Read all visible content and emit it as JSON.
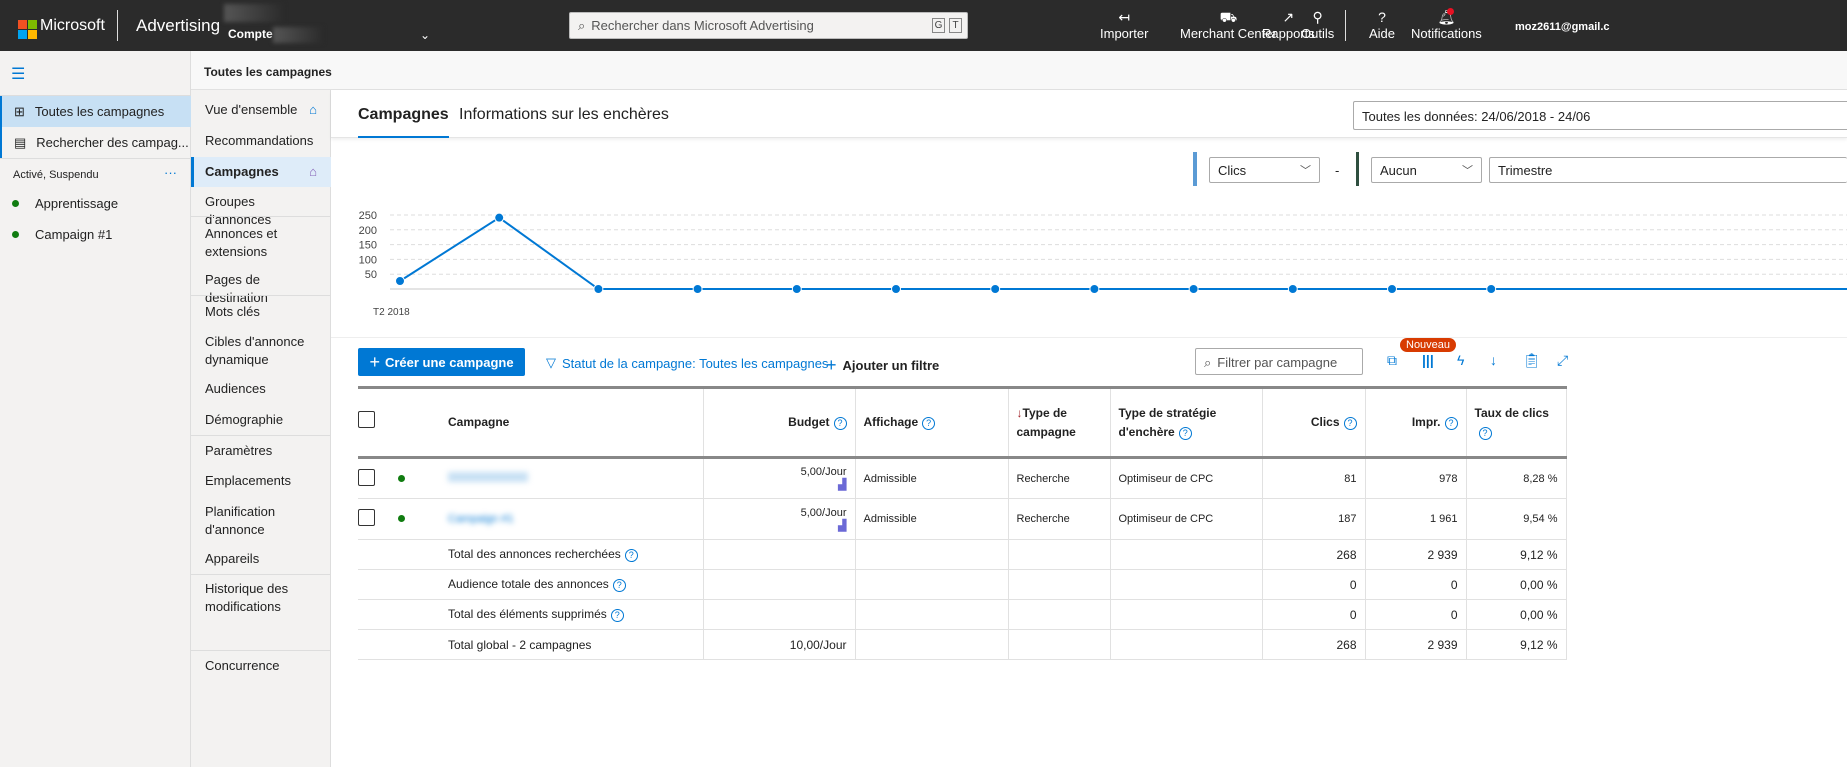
{
  "topbar": {
    "brand": "Microsoft",
    "product": "Advertising",
    "account_label": "Compte",
    "search_placeholder": "Rechercher dans Microsoft Advertising",
    "kbd": [
      "G",
      "T"
    ],
    "nav": [
      {
        "label": "Importer",
        "icon": "import-icon",
        "glyph": "↤"
      },
      {
        "label": "Merchant Center",
        "icon": "cart-icon",
        "glyph": "🛒"
      },
      {
        "label": "Rapports",
        "icon": "chart-icon",
        "glyph": "📈"
      },
      {
        "label": "Outils",
        "icon": "wrench-icon",
        "glyph": "🔧"
      },
      {
        "label": "Aide",
        "icon": "help-icon",
        "glyph": "?"
      },
      {
        "label": "Notifications",
        "icon": "bell-icon",
        "glyph": "🔔"
      }
    ],
    "user": "moz2611@gmail.c"
  },
  "breadcrumb": "Toutes les campagnes",
  "left": {
    "items": [
      "Toutes les campagnes",
      "Rechercher des campag..."
    ],
    "filter_label": "Activé, Suspendu",
    "more": "···",
    "campaigns": [
      "Apprentissage",
      "Campaign #1"
    ]
  },
  "menu": [
    "Vue d'ensemble",
    "Recommandations",
    "Campagnes",
    "Groupes d'annonces",
    "Annonces et extensions",
    "Pages de destination",
    "Mots clés",
    "Cibles d'annonce dynamique",
    "Audiences",
    "Démographie",
    "Paramètres",
    "Emplacements",
    "Planification d'annonce",
    "Appareils",
    "Historique des modifications",
    "Concurrence"
  ],
  "tabs": [
    "Campagnes",
    "Informations sur les enchères"
  ],
  "date_range": "Toutes les données: 24/06/2018 - 24/06",
  "chart_controls": {
    "metric1": "Clics",
    "separator": "-",
    "metric2": "Aucun",
    "period": "Trimestre"
  },
  "chart_data": {
    "type": "line",
    "series": [
      {
        "name": "Clics",
        "values": [
          27,
          241,
          0,
          0,
          0,
          0,
          0,
          0,
          0,
          0,
          0,
          0
        ]
      }
    ],
    "x_ticks": [
      "T2 2018"
    ],
    "y_ticks": [
      50,
      100,
      150,
      200,
      250
    ],
    "ylim": [
      0,
      260
    ],
    "grid": true,
    "color": "#0078d4"
  },
  "toolbar": {
    "create": "Créer une campagne",
    "status_filter": "Statut de la campagne: Toutes les campagnes",
    "add_filter": "Ajouter un filtre",
    "filter_placeholder": "Filtrer par campagne",
    "new_badge": "Nouveau"
  },
  "table": {
    "headers": [
      "Campagne",
      "Budget",
      "Affichage",
      "Type de campagne",
      "Type de stratégie d'enchère",
      "Clics",
      "Impr.",
      "Taux de clics"
    ],
    "rows": [
      {
        "name": "",
        "budget": "5,00/Jour",
        "display": "Admissible",
        "type": "Recherche",
        "strategy": "Optimiseur de CPC",
        "clicks": "81",
        "impr": "978",
        "ctr": "8,28 %"
      },
      {
        "name": "Campaign #1",
        "budget": "5,00/Jour",
        "display": "Admissible",
        "type": "Recherche",
        "strategy": "Optimiseur de CPC",
        "clicks": "187",
        "impr": "1 961",
        "ctr": "9,54 %"
      }
    ],
    "summary": [
      {
        "label": "Total des annonces recherchées",
        "budget": "",
        "clicks": "268",
        "impr": "2 939",
        "ctr": "9,12 %"
      },
      {
        "label": "Audience totale des annonces",
        "budget": "",
        "clicks": "0",
        "impr": "0",
        "ctr": "0,00 %"
      },
      {
        "label": "Total des éléments supprimés",
        "budget": "",
        "clicks": "0",
        "impr": "0",
        "ctr": "0,00 %"
      },
      {
        "label": "Total global - 2 campagnes",
        "budget": "10,00/Jour",
        "clicks": "268",
        "impr": "2 939",
        "ctr": "9,12 %"
      }
    ]
  }
}
